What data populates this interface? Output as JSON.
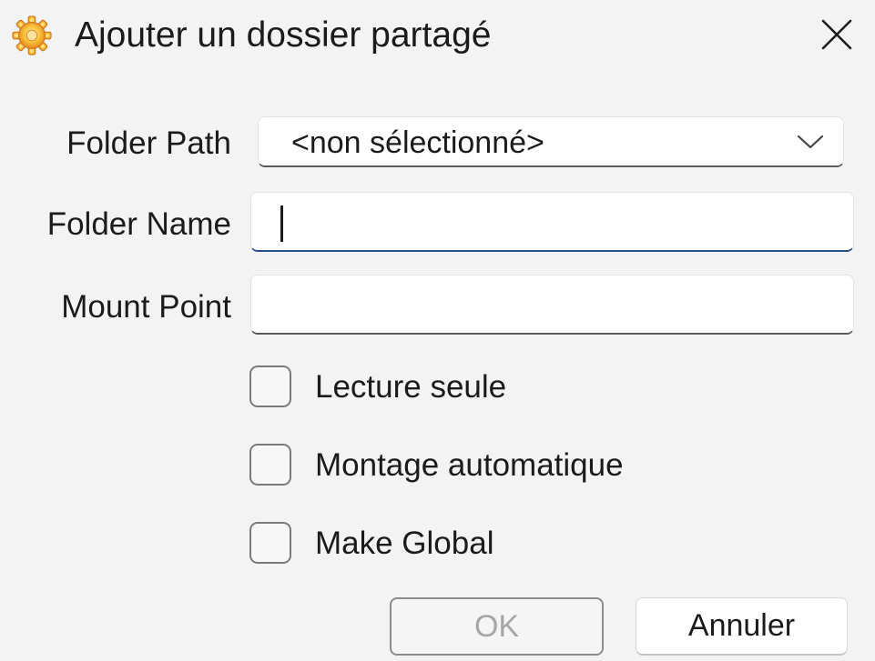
{
  "window": {
    "title": "Ajouter un dossier partagé",
    "icon": "gear-icon",
    "close_icon": "close-icon"
  },
  "form": {
    "folder_path": {
      "label": "Folder Path",
      "value": "<non sélectionné>"
    },
    "folder_name": {
      "label": "Folder Name",
      "value": ""
    },
    "mount_point": {
      "label": "Mount Point",
      "value": ""
    },
    "checkboxes": [
      {
        "label": "Lecture seule",
        "checked": false
      },
      {
        "label": "Montage automatique",
        "checked": false
      },
      {
        "label": "Make Global",
        "checked": false
      }
    ]
  },
  "buttons": {
    "ok_label": "OK",
    "cancel_label": "Annuler"
  },
  "colors": {
    "background": "#f3f3f3",
    "focus_underline": "#2b4f8a",
    "gear_orange": "#f5a623",
    "disabled_text": "#a6a6a6"
  }
}
